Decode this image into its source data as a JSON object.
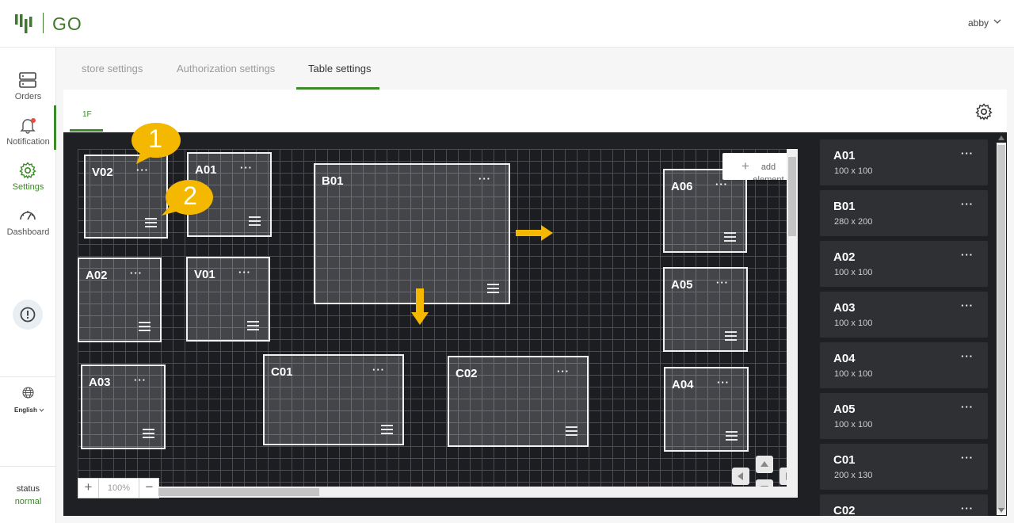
{
  "app": {
    "logo_text": "GO",
    "user": "abby"
  },
  "sidebar": {
    "items": [
      {
        "label": "Orders",
        "icon": "server-icon"
      },
      {
        "label": "Notification",
        "icon": "bell-icon"
      },
      {
        "label": "Settings",
        "icon": "gear-icon",
        "active": true
      },
      {
        "label": "Dashboard",
        "icon": "gauge-icon"
      }
    ],
    "language": "English",
    "status_label": "status",
    "status_value": "normal"
  },
  "tabs": [
    {
      "label": "store settings"
    },
    {
      "label": "Authorization settings"
    },
    {
      "label": "Table settings",
      "active": true
    }
  ],
  "floors": [
    {
      "label": "1F",
      "active": true
    }
  ],
  "canvas": {
    "tables": [
      {
        "name": "V02"
      },
      {
        "name": "A01"
      },
      {
        "name": "B01"
      },
      {
        "name": "A06"
      },
      {
        "name": "A02"
      },
      {
        "name": "V01"
      },
      {
        "name": "A05"
      },
      {
        "name": "A03"
      },
      {
        "name": "C01"
      },
      {
        "name": "C02"
      },
      {
        "name": "A04"
      }
    ],
    "menu_glyph": "···",
    "add_element_label": "add element",
    "zoom": {
      "minus": "−",
      "plus": "+",
      "value": "100%"
    },
    "callouts": [
      "1",
      "2"
    ]
  },
  "element_list": [
    {
      "name": "A01",
      "size": "100 x 100"
    },
    {
      "name": "B01",
      "size": "280 x 200"
    },
    {
      "name": "A02",
      "size": "100 x 100"
    },
    {
      "name": "A03",
      "size": "100 x 100"
    },
    {
      "name": "A04",
      "size": "100 x 100"
    },
    {
      "name": "A05",
      "size": "100 x 100"
    },
    {
      "name": "C01",
      "size": "200 x 130"
    },
    {
      "name": "C02",
      "size": ""
    }
  ],
  "colors": {
    "accent": "#3d8a2a",
    "canvas": "#1f2023",
    "callout": "#f5b800"
  }
}
